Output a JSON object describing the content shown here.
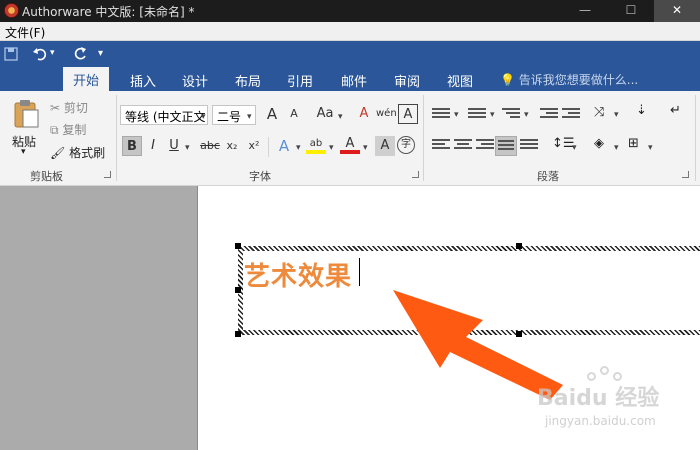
{
  "window": {
    "title": "Authorware 中文版: [未命名] *",
    "controls": [
      "—",
      "☐",
      "✕"
    ]
  },
  "menubar": {
    "file": "文件(F)"
  },
  "quick_access": {
    "save_icon": "save-icon",
    "undo_icon": "undo-icon",
    "redo_icon": "redo-icon",
    "customize": "▾"
  },
  "tabs": [
    {
      "label": "开始",
      "active": true
    },
    {
      "label": "插入"
    },
    {
      "label": "设计"
    },
    {
      "label": "布局"
    },
    {
      "label": "引用"
    },
    {
      "label": "邮件"
    },
    {
      "label": "审阅"
    },
    {
      "label": "视图"
    }
  ],
  "tell_me": "告诉我您想要做什么...",
  "clipboard": {
    "group_label": "剪贴板",
    "paste": "粘贴",
    "cut": "剪切",
    "copy": "复制",
    "format_painter": "格式刷"
  },
  "font": {
    "group_label": "字体",
    "font_name": "等线 (中文正文",
    "font_size": "二号",
    "grow": "A",
    "shrink": "A",
    "case": "Aa",
    "clear": "A",
    "phonetic": "wén",
    "border": "A",
    "bold": "B",
    "italic": "I",
    "underline": "U",
    "strike": "abc",
    "subscript": "x₂",
    "superscript": "x²",
    "effects": "A",
    "highlight": "ab",
    "color": "A",
    "shade": "A",
    "enclose": "字"
  },
  "paragraph": {
    "group_label": "段落"
  },
  "document": {
    "text": "艺术效果"
  },
  "watermark": {
    "brand": "Baidu 经验",
    "url": "jingyan.baidu.com"
  },
  "colors": {
    "ribbon_blue": "#2b579a",
    "art_text": "#ed8a3c",
    "arrow": "#ff5a12"
  }
}
